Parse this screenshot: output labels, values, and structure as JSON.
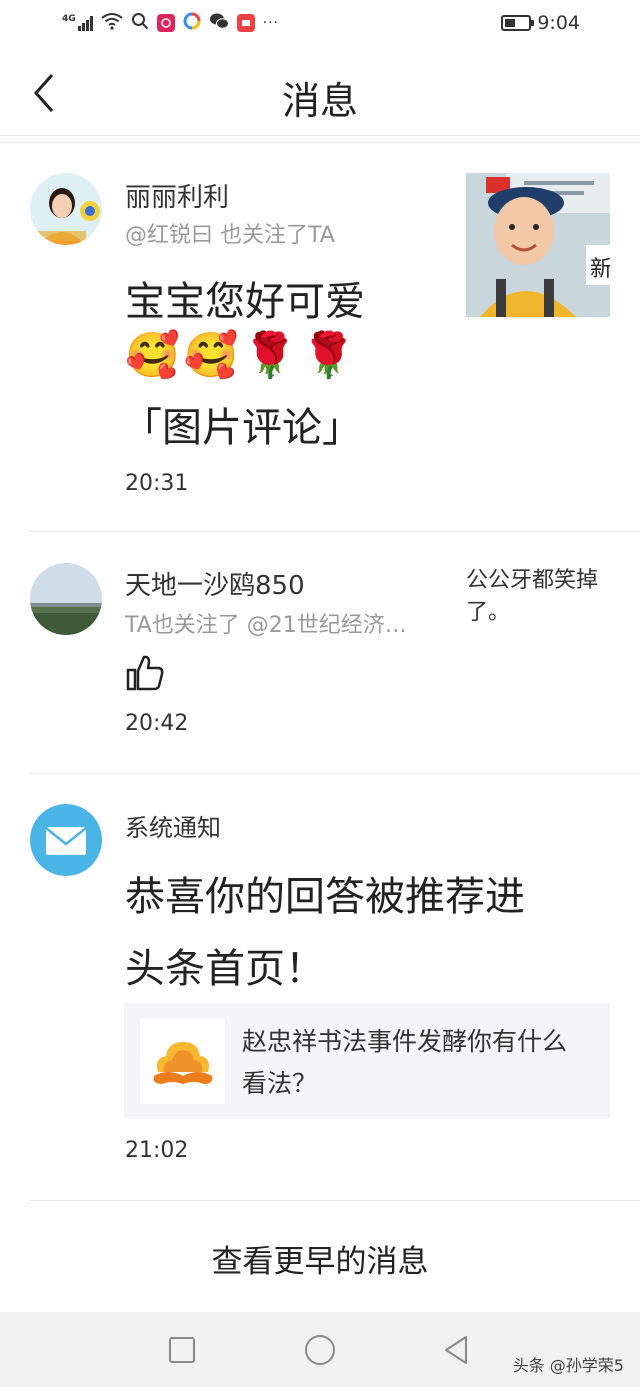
{
  "status_bar": {
    "network": "4G",
    "time": "9:04",
    "battery_level": 0.45,
    "overflow": "···"
  },
  "header": {
    "title": "消息"
  },
  "messages": [
    {
      "name": "丽丽利利",
      "subtitle": "@红锐曰 也关注了TA",
      "content": "宝宝您好可爱",
      "emojis": "🥰🥰🌹🌹",
      "comment_label": "「图片评论」",
      "time": "20:31",
      "thumb_badge": "新"
    },
    {
      "name": "天地一沙鸥850",
      "subtitle": "TA也关注了 @21世纪经济…",
      "side_text": "公公牙都笑掉了。",
      "time": "20:42"
    },
    {
      "name": "系统通知",
      "content_line1": "恭喜你的回答被推荐进",
      "content_line2": "头条首页！",
      "card_text": "赵忠祥书法事件发酵你有什么看法？",
      "time": "21:02"
    }
  ],
  "footer": {
    "more_label": "查看更早的消息"
  },
  "watermark": "头条 @孙学荣5",
  "colors": {
    "system_icon": "#4bb4e6",
    "card_bg": "#f4f5f6",
    "subtitle": "#9a9a9a"
  }
}
